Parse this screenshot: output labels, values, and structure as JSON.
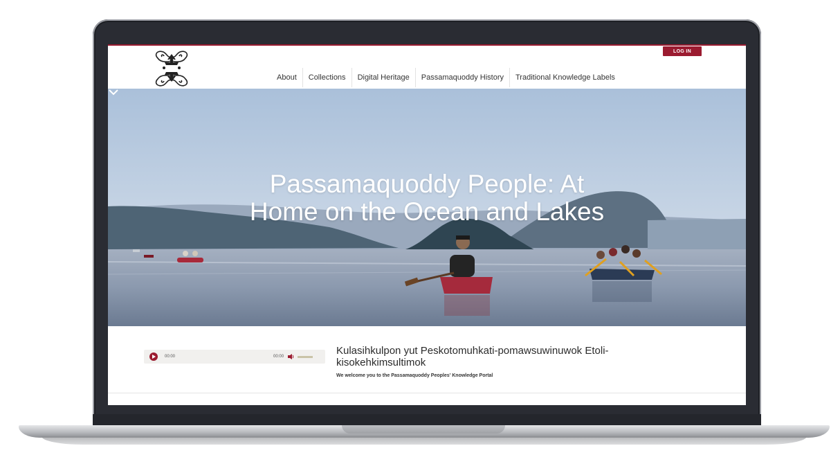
{
  "header": {
    "login_label": "LOG IN",
    "nav": [
      "About",
      "Collections",
      "Digital Heritage",
      "Passamaquoddy History",
      "Traditional Knowledge Labels"
    ]
  },
  "hero": {
    "title_line1": "Passamaquoddy People: At",
    "title_line2": "Home on the Ocean and Lakes"
  },
  "audio": {
    "current_time": "00:00",
    "duration": "00:00"
  },
  "welcome": {
    "title": "Kulasihkulpon yut Peskotomuhkati-pomawsuwinuwok Etoli-kisokehkimsultimok",
    "subtitle": "We welcome you to the Passamaquoddy Peoples' Knowledge Portal"
  },
  "colors": {
    "accent": "#9b1b30",
    "bezel": "#2a2c33"
  }
}
